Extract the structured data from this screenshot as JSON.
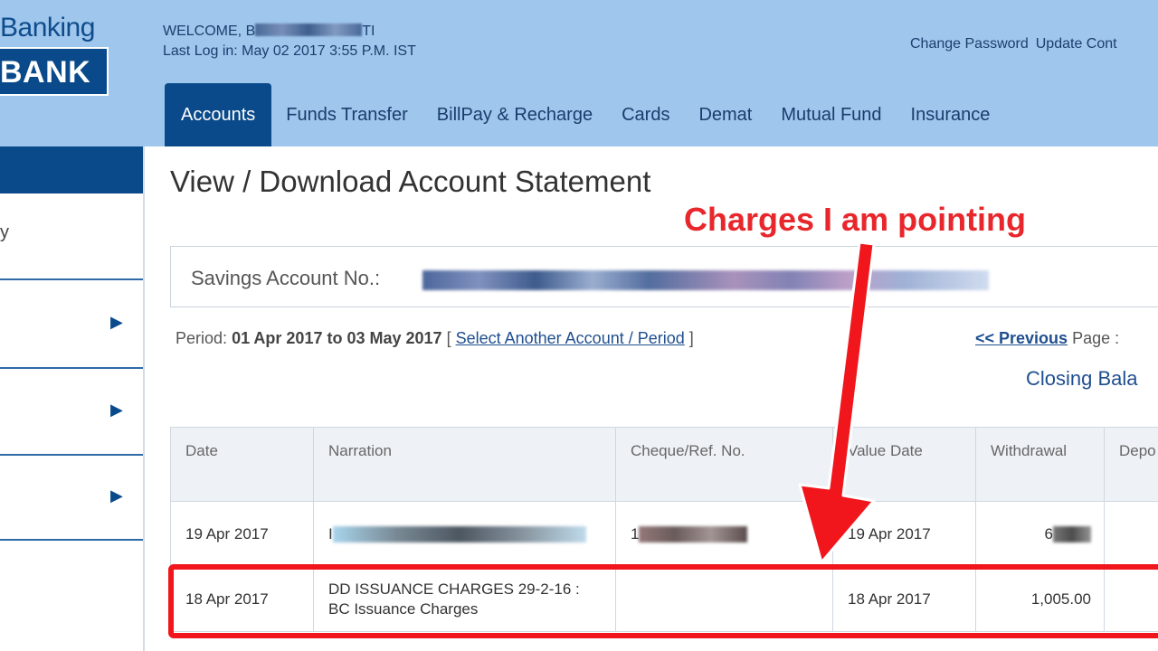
{
  "header": {
    "brand_line1": "Banking",
    "brand_line2": "BANK",
    "welcome_prefix": "WELCOME, B",
    "welcome_suffix": "TI",
    "last_login": "Last Log in: May 02 2017 3:55 P.M. IST",
    "change_password": "Change Password",
    "update_contact": "Update Cont"
  },
  "nav": {
    "tabs": [
      {
        "label": "Accounts",
        "active": true
      },
      {
        "label": "Funds Transfer"
      },
      {
        "label": "BillPay & Recharge"
      },
      {
        "label": "Cards"
      },
      {
        "label": "Demat"
      },
      {
        "label": "Mutual Fund"
      },
      {
        "label": "Insurance"
      }
    ]
  },
  "sidebar": {
    "partial_text": "y",
    "arrow": "▶"
  },
  "main": {
    "title": "View / Download Account Statement",
    "account_label": "Savings Account No.:",
    "period_label": "Period:",
    "period_value": "01 Apr 2017 to 03 May 2017",
    "bracket_open": "[",
    "select_link": "Select Another Account / Period",
    "bracket_close": "]",
    "previous_link": "<< Previous",
    "page_label": "Page :",
    "closing_balance": "Closing Bala"
  },
  "table": {
    "headers": [
      "Date",
      "Narration",
      "Cheque/Ref. No.",
      "Value Date",
      "Withdrawal",
      "Depo"
    ],
    "rows": [
      {
        "date": "19 Apr 2017",
        "narration": "I",
        "cheque": "1",
        "value_date": "19 Apr 2017",
        "withdrawal": "6",
        "deposit": ""
      },
      {
        "date": "18 Apr 2017",
        "narration": "DD ISSUANCE CHARGES 29-2-16 : BC Issuance Charges",
        "cheque": "",
        "value_date": "18 Apr 2017",
        "withdrawal": "1,005.00",
        "deposit": ""
      }
    ]
  },
  "annotation": {
    "text": "Charges I am pointing",
    "color": "#e8272c"
  },
  "colors": {
    "header_bg": "#9fc6ec",
    "brand_blue": "#0a4a8a",
    "highlight_red": "#f0161c"
  }
}
